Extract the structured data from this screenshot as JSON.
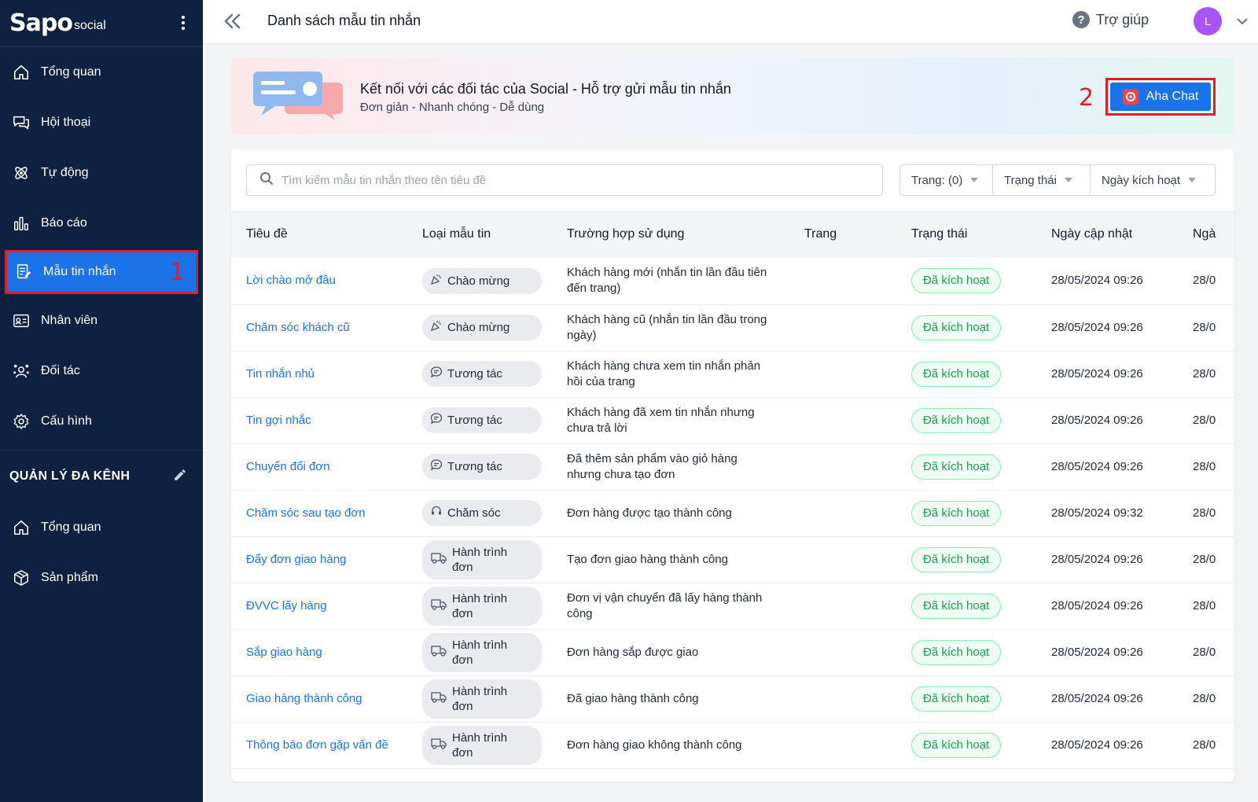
{
  "sidebar": {
    "logo": "Sapo",
    "logo_sub": "social",
    "items": [
      {
        "label": "Tổng quan",
        "icon": "home-icon"
      },
      {
        "label": "Hội thoại",
        "icon": "chat-icon"
      },
      {
        "label": "Tự động",
        "icon": "automation-icon"
      },
      {
        "label": "Báo cáo",
        "icon": "chart-icon"
      },
      {
        "label": "Mẫu tin nhắn",
        "icon": "template-icon",
        "active": true,
        "marker": "1"
      },
      {
        "label": "Nhân viên",
        "icon": "id-card-icon"
      },
      {
        "label": "Đối tác",
        "icon": "partner-icon"
      },
      {
        "label": "Cấu hình",
        "icon": "gear-icon"
      }
    ],
    "section_title": "QUẢN LÝ ĐA KÊNH",
    "section_items": [
      {
        "label": "Tổng quan",
        "icon": "home-icon"
      },
      {
        "label": "Sản phẩm",
        "icon": "box-icon"
      }
    ]
  },
  "topbar": {
    "title": "Danh sách mẫu tin nhắn",
    "help_label": "Trợ giúp",
    "avatar_letter": "L"
  },
  "banner": {
    "title": "Kết nối với các đối tác của Social - Hỗ trợ gửi mẫu tin nhắn",
    "subtitle": "Đơn giản - Nhanh chóng - Dễ dùng",
    "marker": "2",
    "button_label": "Aha Chat"
  },
  "search": {
    "placeholder": "Tìm kiếm mẫu tin nhắn theo tên tiêu đề"
  },
  "filters": {
    "page": "Trang: (0)",
    "status": "Trạng thái",
    "activation_date": "Ngày kích hoạt"
  },
  "table": {
    "columns": [
      "Tiêu đề",
      "Loại mẫu tin",
      "Trường hợp sử dụng",
      "Trang",
      "Trạng thái",
      "Ngày cập nhật",
      "Ngà"
    ],
    "rows": [
      {
        "title": "Lời chào mở đầu",
        "type": "Chào mừng",
        "usage": "Khách hàng mới (nhắn tin lần đầu tiên đến trang)",
        "page": "",
        "status": "Đã kích hoạt",
        "updated": "28/05/2024 09:26",
        "extra": "28/0"
      },
      {
        "title": "Chăm sóc khách cũ",
        "type": "Chào mừng",
        "usage": "Khách hàng cũ (nhắn tin lần đầu trong ngày)",
        "page": "",
        "status": "Đã kích hoạt",
        "updated": "28/05/2024 09:26",
        "extra": "28/0"
      },
      {
        "title": "Tin nhắn nhủ",
        "type": "Tương tác",
        "usage": "Khách hàng chưa xem tin nhắn phản hồi của trang",
        "page": "",
        "status": "Đã kích hoạt",
        "updated": "28/05/2024 09:26",
        "extra": "28/0"
      },
      {
        "title": "Tin gợi nhắc",
        "type": "Tương tác",
        "usage": "Khách hàng đã xem tin nhắn nhưng chưa trả lời",
        "page": "",
        "status": "Đã kích hoạt",
        "updated": "28/05/2024 09:26",
        "extra": "28/0"
      },
      {
        "title": "Chuyển đổi đơn",
        "type": "Tương tác",
        "usage": "Đã thêm sản phẩm vào giỏ hàng nhưng chưa tạo đơn",
        "page": "",
        "status": "Đã kích hoạt",
        "updated": "28/05/2024 09:26",
        "extra": "28/0"
      },
      {
        "title": "Chăm sóc sau tạo đơn",
        "type": "Chăm sóc",
        "usage": "Đơn hàng được tạo thành công",
        "page": "",
        "status": "Đã kích hoạt",
        "updated": "28/05/2024 09:32",
        "extra": "28/0"
      },
      {
        "title": "Đẩy đơn giao hàng",
        "type": "Hành trình đơn",
        "usage": "Tạo đơn giao hàng thành công",
        "page": "",
        "status": "Đã kích hoạt",
        "updated": "28/05/2024 09:26",
        "extra": "28/0"
      },
      {
        "title": "ĐVVC lấy hàng",
        "type": "Hành trình đơn",
        "usage": "Đơn vị vận chuyển đã lấy hàng thành công",
        "page": "",
        "status": "Đã kích hoạt",
        "updated": "28/05/2024 09:26",
        "extra": "28/0"
      },
      {
        "title": "Sắp giao hàng",
        "type": "Hành trình đơn",
        "usage": "Đơn hàng sắp được giao",
        "page": "",
        "status": "Đã kích hoạt",
        "updated": "28/05/2024 09:26",
        "extra": "28/0"
      },
      {
        "title": "Giao hàng thành công",
        "type": "Hành trình đơn",
        "usage": "Đã giao hàng thành công",
        "page": "",
        "status": "Đã kích hoạt",
        "updated": "28/05/2024 09:26",
        "extra": "28/0"
      },
      {
        "title": "Thông báo đơn gặp vấn đề",
        "type": "Hành trình đơn",
        "usage": "Đơn hàng giao không thành công",
        "page": "",
        "status": "Đã kích hoạt",
        "updated": "28/05/2024 09:26",
        "extra": "28/0"
      }
    ]
  },
  "colors": {
    "sidebar_bg": "#0f2140",
    "accent": "#1a73e8",
    "highlight_red": "#e11d2a",
    "status_green": "#16a34a"
  }
}
